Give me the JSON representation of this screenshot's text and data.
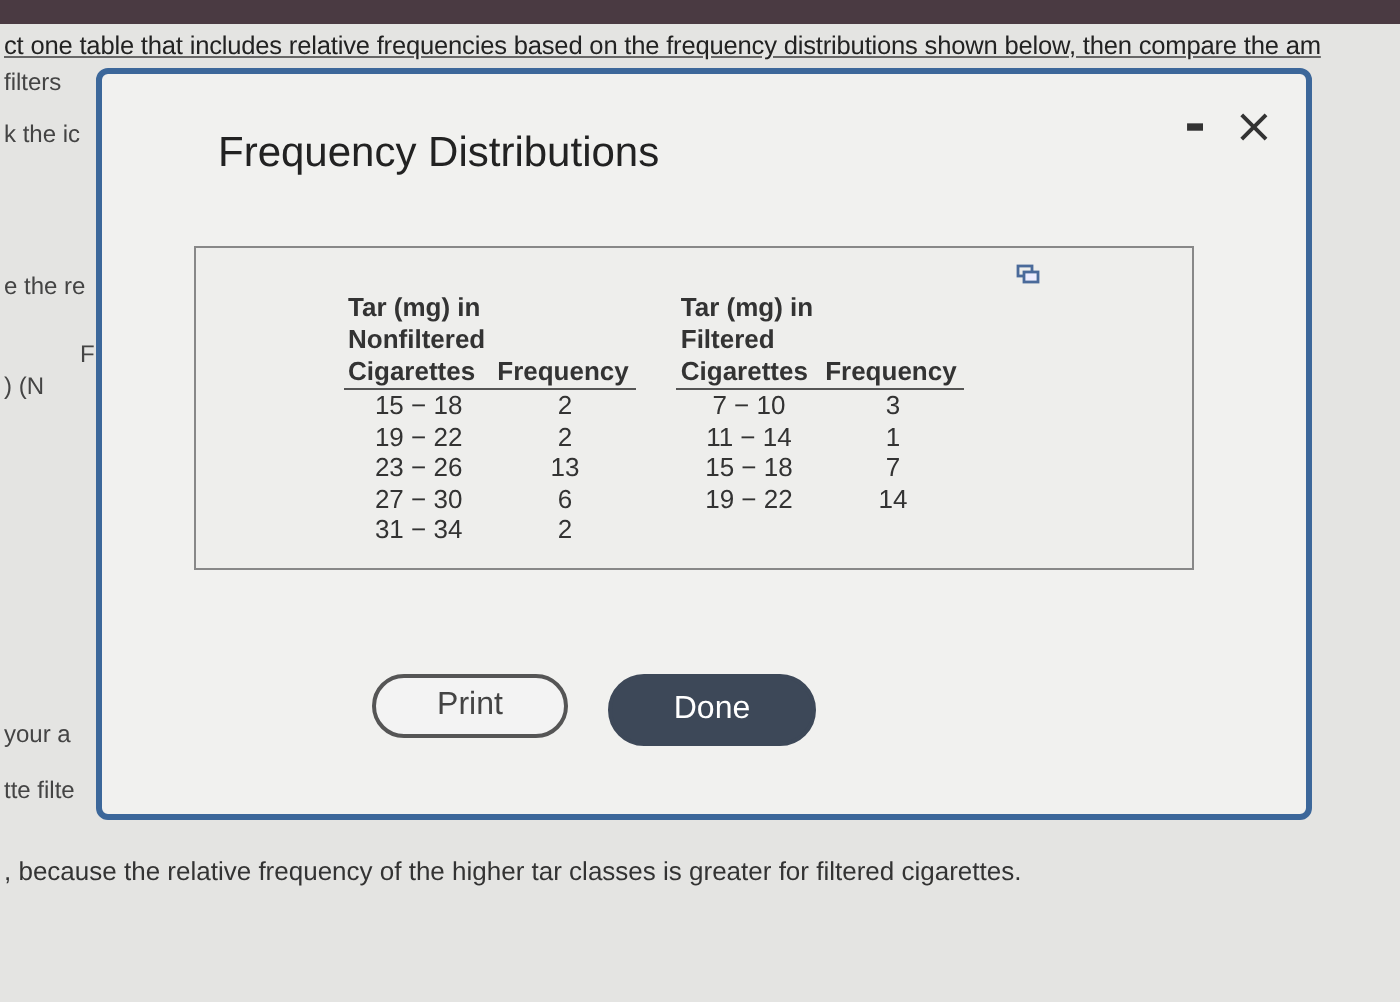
{
  "background": {
    "question": "ct one table that includes relative frequencies based on the frequency distributions shown below, then compare the am",
    "fragments": [
      "filters",
      "k the ic",
      "e the re",
      "F",
      ") (N"
    ],
    "lower_fragments": [
      "your a",
      "tte filte"
    ],
    "answer": ", because the relative frequency of the higher tar classes is greater for filtered cigarettes."
  },
  "dialog": {
    "title": "Frequency Distributions",
    "minimize": "-",
    "close": "×",
    "tables": [
      {
        "header": [
          "Tar (mg) in",
          "Nonfiltered",
          "Cigarettes"
        ],
        "freq_header": "Frequency",
        "rows": [
          [
            "15 − 18",
            "2"
          ],
          [
            "19 − 22",
            "2"
          ],
          [
            "23 − 26",
            "13"
          ],
          [
            "27 − 30",
            "6"
          ],
          [
            "31 − 34",
            "2"
          ]
        ]
      },
      {
        "header": [
          "Tar (mg) in",
          "Filtered",
          "Cigarettes"
        ],
        "freq_header": "Frequency",
        "rows": [
          [
            "7 − 10",
            "3"
          ],
          [
            "11 − 14",
            "1"
          ],
          [
            "15 − 18",
            "7"
          ],
          [
            "19 − 22",
            "14"
          ]
        ]
      }
    ],
    "buttons": [
      {
        "label": "Print",
        "kind": "secondary"
      },
      {
        "label": "Done",
        "kind": "primary"
      }
    ]
  }
}
